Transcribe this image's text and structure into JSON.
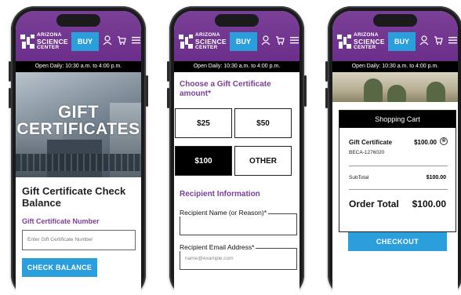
{
  "header": {
    "logo_line1": "ARIZONA",
    "logo_line2": "SCIENCE",
    "logo_line3": "CENTER",
    "buy_label": "BUY",
    "icons": [
      "user-icon",
      "cart-icon",
      "menu-icon"
    ],
    "hours": "Open Daily: 10:30 a.m. to 4:00 p.m."
  },
  "colors": {
    "brand_purple": "#6b2f8a",
    "accent_blue": "#2a9fdc",
    "black": "#000000"
  },
  "phone1": {
    "hero_line1": "GIFT",
    "hero_line2": "CERTIFICATES",
    "title": "Gift Certificate Check Balance",
    "field_label": "Gift Certificate Number",
    "field_placeholder": "Enter Gift Certificate Number",
    "button": "CHECK BALANCE"
  },
  "phone2": {
    "heading": "Choose a Gift Certificate amount*",
    "amounts": [
      {
        "label": "$25",
        "selected": false
      },
      {
        "label": "$50",
        "selected": false
      },
      {
        "label": "$100",
        "selected": true
      },
      {
        "label": "OTHER",
        "selected": false
      }
    ],
    "section": "Recipient Information",
    "recipient_name_label": "Recipient Name (or Reason)*",
    "recipient_email_label": "Recipient Email Address*",
    "recipient_email_placeholder": "name@example.com"
  },
  "phone3": {
    "cart_title": "Shopping Cart",
    "item_name": "Gift Certificate",
    "item_price": "$100.00",
    "item_sku": "BECA-1276020",
    "subtotal_label": "SubTotal",
    "subtotal_value": "$100.00",
    "total_label": "Order Total",
    "total_value": "$100.00",
    "checkout": "CHECKOUT"
  }
}
